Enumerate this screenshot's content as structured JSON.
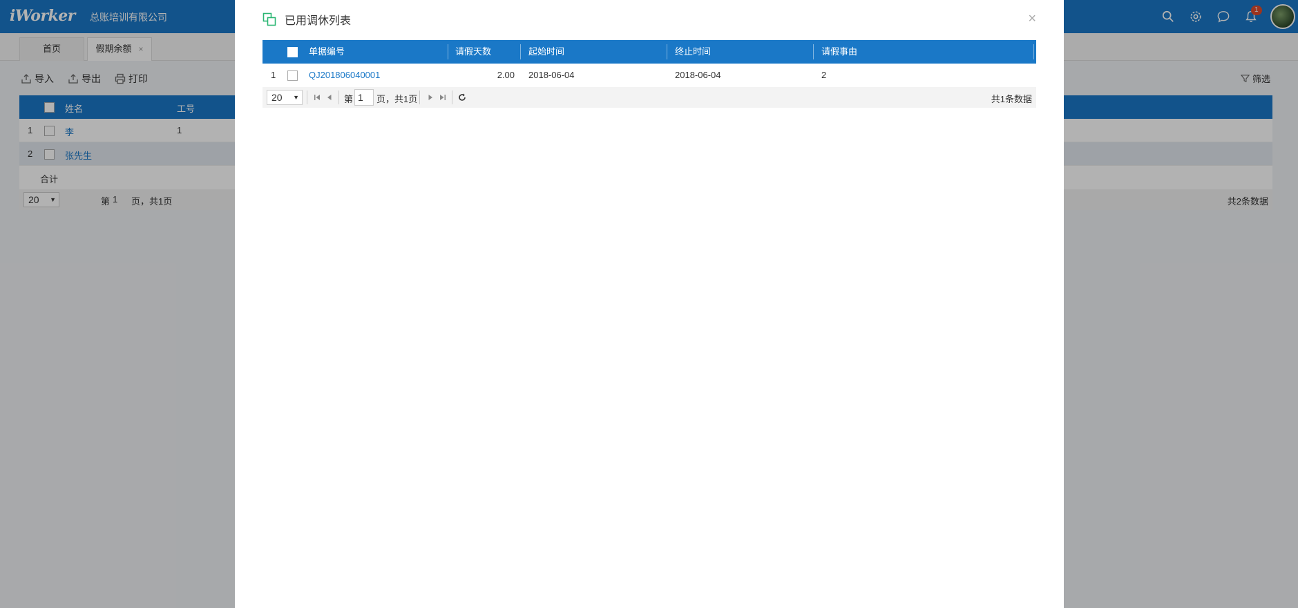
{
  "app": {
    "logo": "iWorker",
    "company": "总账培训有限公司",
    "notification_count": "1"
  },
  "tabs": [
    {
      "label": "首页"
    },
    {
      "label": "假期余额",
      "close": "×"
    }
  ],
  "toolbar": {
    "import_label": "导入",
    "export_label": "导出",
    "print_label": "打印",
    "filter_label": "筛选"
  },
  "bg_grid": {
    "columns": [
      "姓名",
      "工号"
    ],
    "rows": [
      {
        "index": "1",
        "name": "李",
        "id": "1"
      },
      {
        "index": "2",
        "name": "张先生",
        "id": ""
      }
    ],
    "summary_label": "合计",
    "pager": {
      "page_size": "20",
      "page_prefix": "第",
      "page_value": "1",
      "page_suffix": "页，共1页",
      "total": "共2条数据"
    }
  },
  "modal": {
    "title": "已用调休列表",
    "close": "×",
    "columns": {
      "doc_no": "单据编号",
      "days": "请假天数",
      "start": "起始时间",
      "end": "终止时间",
      "reason": "请假事由"
    },
    "rows": [
      {
        "index": "1",
        "doc_no": "QJ201806040001",
        "days": "2.00",
        "start": "2018-06-04",
        "end": "2018-06-04",
        "reason": "2"
      }
    ],
    "pager": {
      "page_size": "20",
      "page_prefix": "第",
      "page_value": "1",
      "page_suffix": "页，共1页",
      "total": "共1条数据"
    }
  },
  "colors": {
    "primary": "#1a78c7",
    "overlay": "rgba(0,0,0,0.3)",
    "modal_icon": "#2bb673"
  }
}
